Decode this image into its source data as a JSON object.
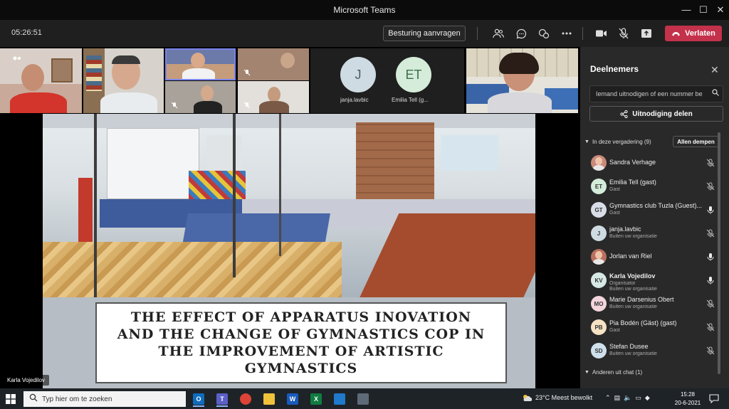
{
  "app": {
    "window_title": "Microsoft Teams",
    "window_controls": [
      "—",
      "☐",
      "✕"
    ]
  },
  "meeting_bar": {
    "timer": "05:26:51",
    "request_control_label": "Besturing aanvragen",
    "leave_label": "Verlaten",
    "tool_icons": [
      "people-icon",
      "chat-icon",
      "reactions-icon",
      "more-icon",
      "camera-icon",
      "mic-off-icon",
      "share-icon"
    ]
  },
  "video_tiles": {
    "audio_only": [
      {
        "initials": "J",
        "name": "janja.lavbic",
        "color": "#cfdbe2"
      },
      {
        "initials": "ET",
        "name": "Emilia Tell (g...",
        "color": "#d4ecd9"
      }
    ]
  },
  "slide": {
    "title": "THE EFFECT OF APPARATUS INOVATION AND THE CHANGE OF GYMNASTICS COP IN THE IMPROVEMENT OF ARTISTIC GYMNASTICS",
    "speaker_label": "Karla Vojedilov"
  },
  "participants_panel": {
    "title": "Deelnemers",
    "invite_placeholder": "Iemand uitnodigen of een nummer be",
    "share_invite_label": "Uitnodiging delen",
    "in_meeting_label": "In deze vergadering (9)",
    "mute_all_label": "Allen dempen",
    "others_label": "Anderen uit chat (1)",
    "people": [
      {
        "name": "Sandra Verhage",
        "role": "",
        "role2": "",
        "initials": "",
        "avatar_color": "#c98a7a",
        "photo": true,
        "mic": "off",
        "bold": false
      },
      {
        "name": "Emilia Tell (gast)",
        "role": "Gast",
        "role2": "",
        "initials": "ET",
        "avatar_color": "#d4ecd9",
        "photo": false,
        "mic": "off",
        "bold": false
      },
      {
        "name": "Gymnastics club Tuzla (Guest)...",
        "role": "Gast",
        "role2": "",
        "initials": "GT",
        "avatar_color": "#d9dde8",
        "photo": false,
        "mic": "on",
        "bold": false
      },
      {
        "name": "janja.lavbic",
        "role": "Buiten uw organisatie",
        "role2": "",
        "initials": "J",
        "avatar_color": "#cfdbe2",
        "photo": false,
        "mic": "off",
        "bold": false
      },
      {
        "name": "Jorlan van Riel",
        "role": "",
        "role2": "",
        "initials": "",
        "avatar_color": "#b87060",
        "photo": true,
        "mic": "on",
        "bold": false
      },
      {
        "name": "Karla Vojedilov",
        "role": "Organisator",
        "role2": "Buiten uw organisatie",
        "initials": "KV",
        "avatar_color": "#d6e8e4",
        "photo": false,
        "mic": "on",
        "bold": true
      },
      {
        "name": "Marie Darsenius Obert",
        "role": "Buiten uw organisatie",
        "role2": "",
        "initials": "MO",
        "avatar_color": "#f2d6dc",
        "photo": false,
        "mic": "off",
        "bold": false
      },
      {
        "name": "Pia Bodén (Gäst) (gast)",
        "role": "Gast",
        "role2": "",
        "initials": "PB",
        "avatar_color": "#f6e2c4",
        "photo": false,
        "mic": "off",
        "bold": false
      },
      {
        "name": "Stefan Dusee",
        "role": "Buiten uw organisatie",
        "role2": "",
        "initials": "SD",
        "avatar_color": "#cfe0ec",
        "photo": false,
        "mic": "off",
        "bold": false
      }
    ]
  },
  "taskbar": {
    "search_placeholder": "Typ hier om te zoeken",
    "weather": "23°C  Meest bewolkt",
    "time": "15:28",
    "date": "20-6-2021",
    "apps": [
      {
        "name": "outlook-icon",
        "label": "O",
        "color": "#0f6cbd"
      },
      {
        "name": "teams-icon",
        "label": "T",
        "color": "#5b5fc7"
      },
      {
        "name": "chrome-icon",
        "label": "",
        "color": "#db4437"
      },
      {
        "name": "file-explorer-icon",
        "label": "",
        "color": "#f0c23b"
      },
      {
        "name": "word-icon",
        "label": "W",
        "color": "#185abd"
      },
      {
        "name": "excel-icon",
        "label": "X",
        "color": "#107c41"
      },
      {
        "name": "photos-icon",
        "label": "",
        "color": "#1f7acb"
      },
      {
        "name": "calculator-icon",
        "label": "",
        "color": "#5e6a78"
      }
    ]
  }
}
